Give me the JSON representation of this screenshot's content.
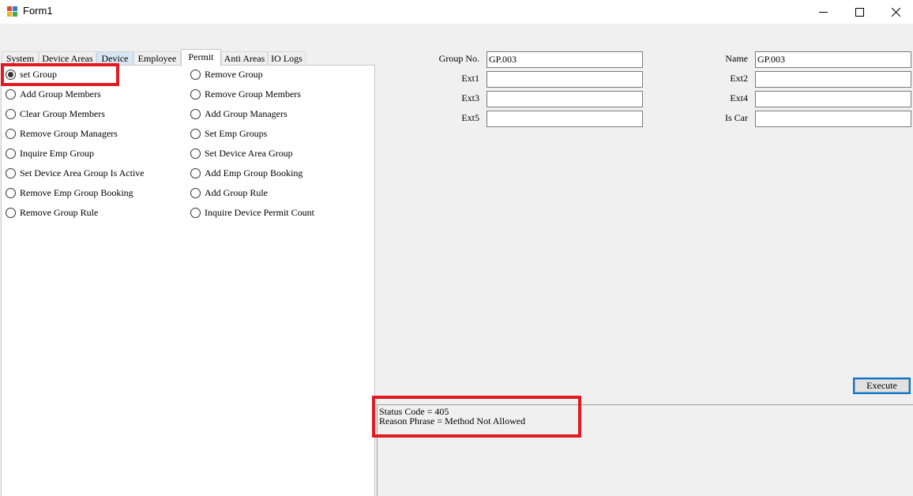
{
  "window": {
    "title": "Form1",
    "icon": "app-icon",
    "minimize_glyph": "minimize-icon",
    "maximize_glyph": "maximize-icon",
    "close_glyph": "close-icon"
  },
  "tabs": [
    {
      "label": "System"
    },
    {
      "label": "Device Areas"
    },
    {
      "label": "Device"
    },
    {
      "label": "Employee"
    },
    {
      "label": "Permit"
    },
    {
      "label": "Anti Areas"
    },
    {
      "label": "IO Logs"
    }
  ],
  "active_tab": "Permit",
  "options": [
    {
      "label": "set Group",
      "selected": true
    },
    {
      "label": "Remove Group",
      "selected": false
    },
    {
      "label": "Add Group Members",
      "selected": false
    },
    {
      "label": "Remove Group Members",
      "selected": false
    },
    {
      "label": "Clear Group Members",
      "selected": false
    },
    {
      "label": "Add Group Managers",
      "selected": false
    },
    {
      "label": "Remove Group Managers",
      "selected": false
    },
    {
      "label": "Set Emp Groups",
      "selected": false
    },
    {
      "label": "Inquire Emp Group",
      "selected": false
    },
    {
      "label": "Set Device Area Group",
      "selected": false
    },
    {
      "label": "Set Device Area Group Is Active",
      "selected": false
    },
    {
      "label": "Add Emp Group Booking",
      "selected": false
    },
    {
      "label": "Remove Emp Group Booking",
      "selected": false
    },
    {
      "label": "Add Group Rule",
      "selected": false
    },
    {
      "label": "Remove Group Rule",
      "selected": false
    },
    {
      "label": "Inquire Device Permit Count",
      "selected": false
    }
  ],
  "fields": {
    "group_no": {
      "label": "Group No.",
      "value": "GP.003"
    },
    "name": {
      "label": "Name",
      "value": "GP.003"
    },
    "ext1": {
      "label": "Ext1",
      "value": ""
    },
    "ext2": {
      "label": "Ext2",
      "value": ""
    },
    "ext3": {
      "label": "Ext3",
      "value": ""
    },
    "ext4": {
      "label": "Ext4",
      "value": ""
    },
    "ext5": {
      "label": "Ext5",
      "value": ""
    },
    "is_car": {
      "label": "Is Car",
      "value": ""
    }
  },
  "execute_label": "Execute",
  "output": {
    "line1": "Status Code = 405",
    "line2": "Reason Phrase = Method Not Allowed"
  },
  "colors": {
    "highlight": "#e21b23",
    "focus_border": "#0078d7",
    "tab_hover": "#d8e6f2"
  }
}
